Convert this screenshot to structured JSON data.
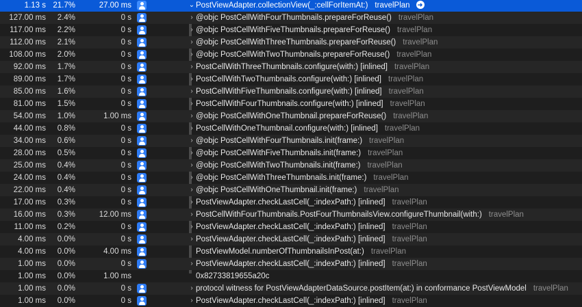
{
  "rows": [
    {
      "weight": "1.13 s",
      "pct": "21.7%",
      "self": "27.00 ms",
      "icon": true,
      "symbol": "PostViewAdapter.collectionView(_:cellForItemAt:)",
      "library": "travelPlan",
      "chevron": "down",
      "selected": true
    },
    {
      "weight": "127.00 ms",
      "pct": "2.4%",
      "self": "0 s",
      "icon": true,
      "symbol": "@objc PostCellWithFourThumbnails.prepareForReuse()",
      "library": "travelPlan",
      "chevron": "right"
    },
    {
      "weight": "117.00 ms",
      "pct": "2.2%",
      "self": "0 s",
      "icon": true,
      "symbol": "@objc PostCellWithFiveThumbnails.prepareForReuse()",
      "library": "travelPlan",
      "chevron": "right"
    },
    {
      "weight": "112.00 ms",
      "pct": "2.1%",
      "self": "0 s",
      "icon": true,
      "symbol": "@objc PostCellWithThreeThumbnails.prepareForReuse()",
      "library": "travelPlan",
      "chevron": "right"
    },
    {
      "weight": "108.00 ms",
      "pct": "2.0%",
      "self": "0 s",
      "icon": true,
      "symbol": "@objc PostCellWithTwoThumbnails.prepareForReuse()",
      "library": "travelPlan",
      "chevron": "right"
    },
    {
      "weight": "92.00 ms",
      "pct": "1.7%",
      "self": "0 s",
      "icon": true,
      "symbol": "PostCellWithThreeThumbnails.configure(with:) [inlined]",
      "library": "travelPlan",
      "chevron": "right"
    },
    {
      "weight": "89.00 ms",
      "pct": "1.7%",
      "self": "0 s",
      "icon": true,
      "symbol": "PostCellWithTwoThumbnails.configure(with:) [inlined]",
      "library": "travelPlan",
      "chevron": "right"
    },
    {
      "weight": "85.00 ms",
      "pct": "1.6%",
      "self": "0 s",
      "icon": true,
      "symbol": "PostCellWithFiveThumbnails.configure(with:) [inlined]",
      "library": "travelPlan",
      "chevron": "right"
    },
    {
      "weight": "81.00 ms",
      "pct": "1.5%",
      "self": "0 s",
      "icon": true,
      "symbol": "PostCellWithFourThumbnails.configure(with:) [inlined]",
      "library": "travelPlan",
      "chevron": "right"
    },
    {
      "weight": "54.00 ms",
      "pct": "1.0%",
      "self": "1.00 ms",
      "icon": true,
      "symbol": "@objc PostCellWithOneThumbnail.prepareForReuse()",
      "library": "travelPlan",
      "chevron": "right"
    },
    {
      "weight": "44.00 ms",
      "pct": "0.8%",
      "self": "0 s",
      "icon": true,
      "symbol": "PostCellWithOneThumbnail.configure(with:) [inlined]",
      "library": "travelPlan",
      "chevron": "right"
    },
    {
      "weight": "34.00 ms",
      "pct": "0.6%",
      "self": "0 s",
      "icon": true,
      "symbol": "@objc PostCellWithFourThumbnails.init(frame:)",
      "library": "travelPlan",
      "chevron": "right"
    },
    {
      "weight": "28.00 ms",
      "pct": "0.5%",
      "self": "0 s",
      "icon": true,
      "symbol": "@objc PostCellWithFiveThumbnails.init(frame:)",
      "library": "travelPlan",
      "chevron": "right"
    },
    {
      "weight": "25.00 ms",
      "pct": "0.4%",
      "self": "0 s",
      "icon": true,
      "symbol": "@objc PostCellWithTwoThumbnails.init(frame:)",
      "library": "travelPlan",
      "chevron": "right"
    },
    {
      "weight": "24.00 ms",
      "pct": "0.4%",
      "self": "0 s",
      "icon": true,
      "symbol": "@objc PostCellWithThreeThumbnails.init(frame:)",
      "library": "travelPlan",
      "chevron": "right"
    },
    {
      "weight": "22.00 ms",
      "pct": "0.4%",
      "self": "0 s",
      "icon": true,
      "symbol": "@objc PostCellWithOneThumbnail.init(frame:)",
      "library": "travelPlan",
      "chevron": "right"
    },
    {
      "weight": "17.00 ms",
      "pct": "0.3%",
      "self": "0 s",
      "icon": true,
      "symbol": "PostViewAdapter.checkLastCell(_:indexPath:) [inlined]",
      "library": "travelPlan",
      "chevron": "right"
    },
    {
      "weight": "16.00 ms",
      "pct": "0.3%",
      "self": "12.00 ms",
      "icon": true,
      "symbol": "PostCellWithFourThumbnails.PostFourThumbnailsView.configureThumbnail(with:)",
      "library": "travelPlan",
      "chevron": "right"
    },
    {
      "weight": "11.00 ms",
      "pct": "0.2%",
      "self": "0 s",
      "icon": true,
      "symbol": "PostViewAdapter.checkLastCell(_:indexPath:) [inlined]",
      "library": "travelPlan",
      "chevron": "right"
    },
    {
      "weight": "4.00 ms",
      "pct": "0.0%",
      "self": "0 s",
      "icon": true,
      "symbol": "PostViewAdapter.checkLastCell(_:indexPath:) [inlined]",
      "library": "travelPlan",
      "chevron": "right"
    },
    {
      "weight": "4.00 ms",
      "pct": "0.0%",
      "self": "4.00 ms",
      "icon": true,
      "symbol": "PostViewModel.numberOfThumbnailsInPost(at:)",
      "library": "travelPlan",
      "chevron": "none"
    },
    {
      "weight": "1.00 ms",
      "pct": "0.0%",
      "self": "0 s",
      "icon": true,
      "symbol": "PostViewAdapter.checkLastCell(_:indexPath:) [inlined]",
      "library": "travelPlan",
      "chevron": "right"
    },
    {
      "weight": "1.00 ms",
      "pct": "0.0%",
      "self": "1.00 ms",
      "icon": false,
      "symbol": "0x82733819655a20c",
      "library": "",
      "chevron": "none"
    },
    {
      "weight": "1.00 ms",
      "pct": "0.0%",
      "self": "0 s",
      "icon": true,
      "symbol": "protocol witness for PostViewAdapterDataSource.postItem(at:) in conformance PostViewModel",
      "library": "travelPlan",
      "chevron": "right"
    },
    {
      "weight": "1.00 ms",
      "pct": "0.0%",
      "self": "0 s",
      "icon": true,
      "symbol": "PostViewAdapter.checkLastCell(_:indexPath:) [inlined]",
      "library": "travelPlan",
      "chevron": "right"
    }
  ],
  "colors": {
    "selection": "#0a5ad8",
    "user_icon": "#2e7cf6",
    "background": "#1e1e1e"
  },
  "icons": {
    "user_code": "user-code-icon",
    "expand": "chevron-right-icon",
    "collapse": "chevron-down-icon",
    "focus": "arrow-circle-right-icon"
  }
}
